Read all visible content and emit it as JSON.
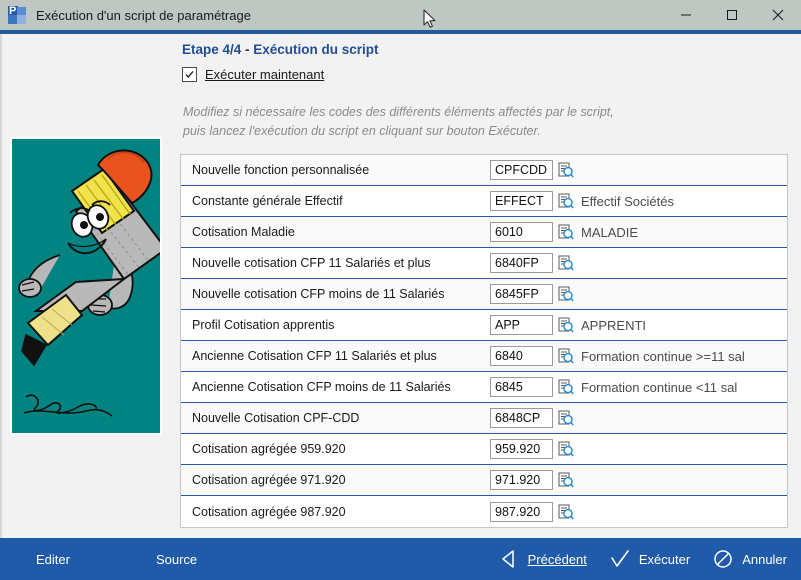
{
  "window": {
    "title": "Exécution d'un script de paramétrage",
    "icon": "app-icon",
    "minimize_label": "—",
    "maximize_label": "▢",
    "close_label": "✕",
    "accent_color": "#245a9e",
    "titlebar_color": "#bfc7c3"
  },
  "header": {
    "step_prefix": "Etape 4/4",
    "step_separator": " - ",
    "step_name": "Exécution du script",
    "checkbox_label": "Exécuter maintenant",
    "checkbox_checked": true,
    "hint": "Modifiez si nécessaire les codes des différents éléments affectés par le script,\npuis lancez l'exécution du script en cliquant sur bouton Exécuter."
  },
  "illustration": {
    "name": "pencil-mascot-image",
    "background_color": "#018382"
  },
  "table": {
    "rows": [
      {
        "label": "Nouvelle fonction personnalisée",
        "code": "CPFCDD",
        "desc": ""
      },
      {
        "label": "Constante générale Effectif",
        "code": "EFFECT",
        "desc": "Effectif Sociétés"
      },
      {
        "label": "Cotisation Maladie",
        "code": "6010",
        "desc": "MALADIE"
      },
      {
        "label": "Nouvelle cotisation CFP 11 Salariés et plus",
        "code": "6840FP",
        "desc": ""
      },
      {
        "label": "Nouvelle cotisation CFP moins de 11 Salariés",
        "code": "6845FP",
        "desc": ""
      },
      {
        "label": "Profil Cotisation apprentis",
        "code": "APP",
        "desc": "APPRENTI"
      },
      {
        "label": "Ancienne Cotisation CFP 11 Salariés et plus",
        "code": "6840",
        "desc": "Formation continue >=11 sal"
      },
      {
        "label": "Ancienne Cotisation CFP moins de 11 Salariés",
        "code": "6845",
        "desc": "Formation continue <11 sal"
      },
      {
        "label": "Nouvelle Cotisation CPF-CDD",
        "code": "6848CP",
        "desc": ""
      },
      {
        "label": "Cotisation agrégée 959.920",
        "code": "959.920",
        "desc": ""
      },
      {
        "label": "Cotisation agrégée 971.920",
        "code": "971.920",
        "desc": ""
      },
      {
        "label": "Cotisation agrégée 987.920",
        "code": "987.920",
        "desc": ""
      }
    ],
    "lookup_icon": "document-search-icon"
  },
  "toolbar": {
    "background_color": "#1f5ba8",
    "left_items": [
      {
        "label": "Editer"
      },
      {
        "label": "Source"
      }
    ],
    "right_items": [
      {
        "label": "Précédent",
        "icon": "back-triangle-icon"
      },
      {
        "label": "Exécuter",
        "icon": "check-icon"
      },
      {
        "label": "Annuler",
        "icon": "cancel-circle-icon"
      }
    ]
  }
}
